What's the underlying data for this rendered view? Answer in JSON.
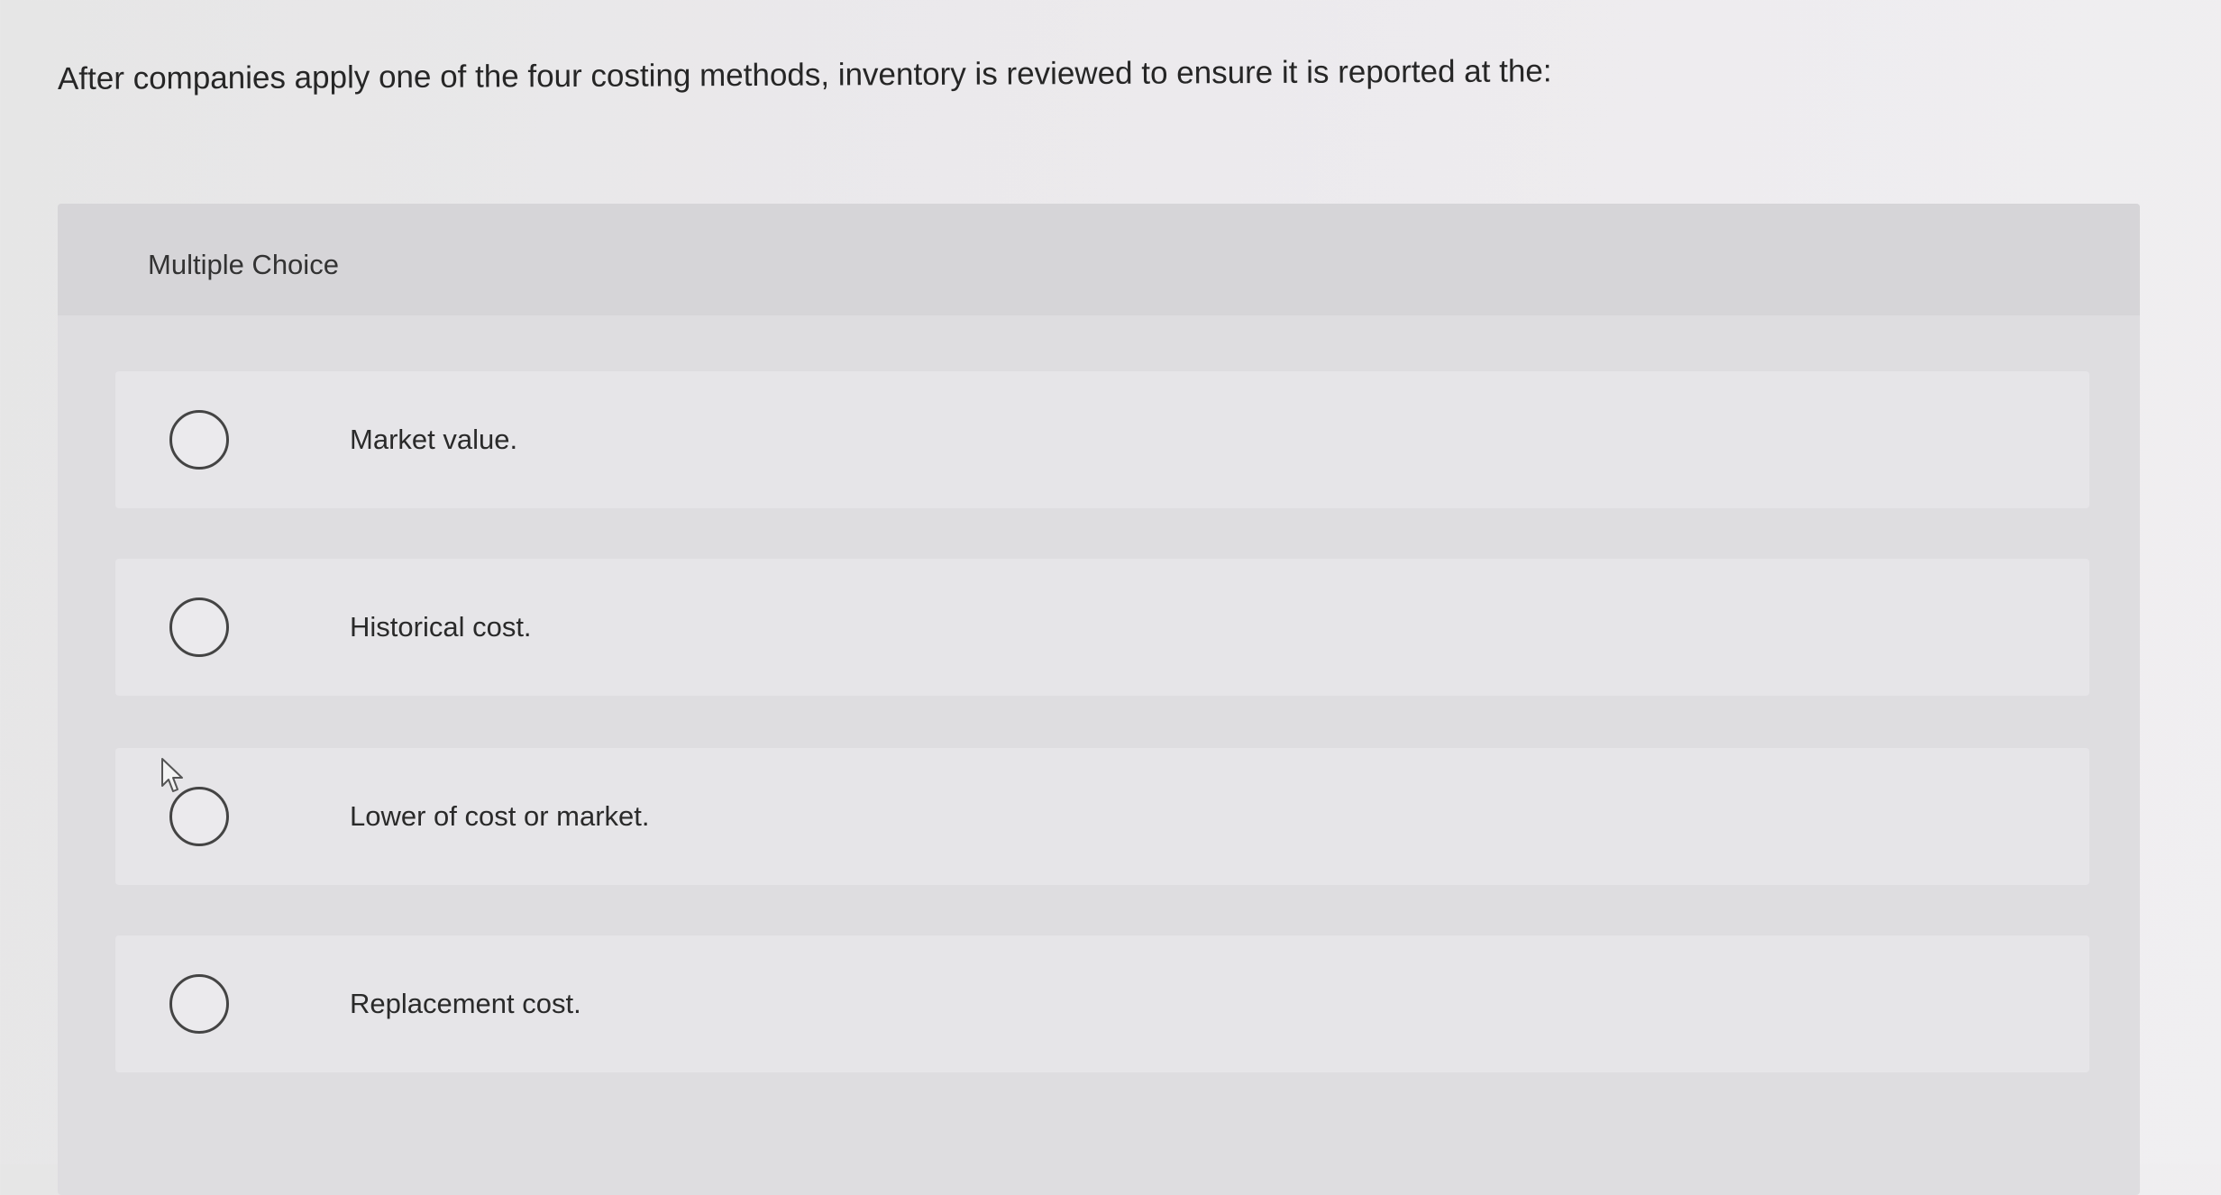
{
  "question": {
    "text": "After companies apply one of the four costing methods, inventory is reviewed to ensure it is reported at the:"
  },
  "panel": {
    "header_label": "Multiple Choice"
  },
  "options": [
    {
      "label": "Market value."
    },
    {
      "label": "Historical cost."
    },
    {
      "label": "Lower of cost or market."
    },
    {
      "label": "Replacement cost."
    }
  ],
  "icons": {
    "cursor": "mouse-pointer-icon",
    "radio": "radio-unchecked-icon"
  }
}
